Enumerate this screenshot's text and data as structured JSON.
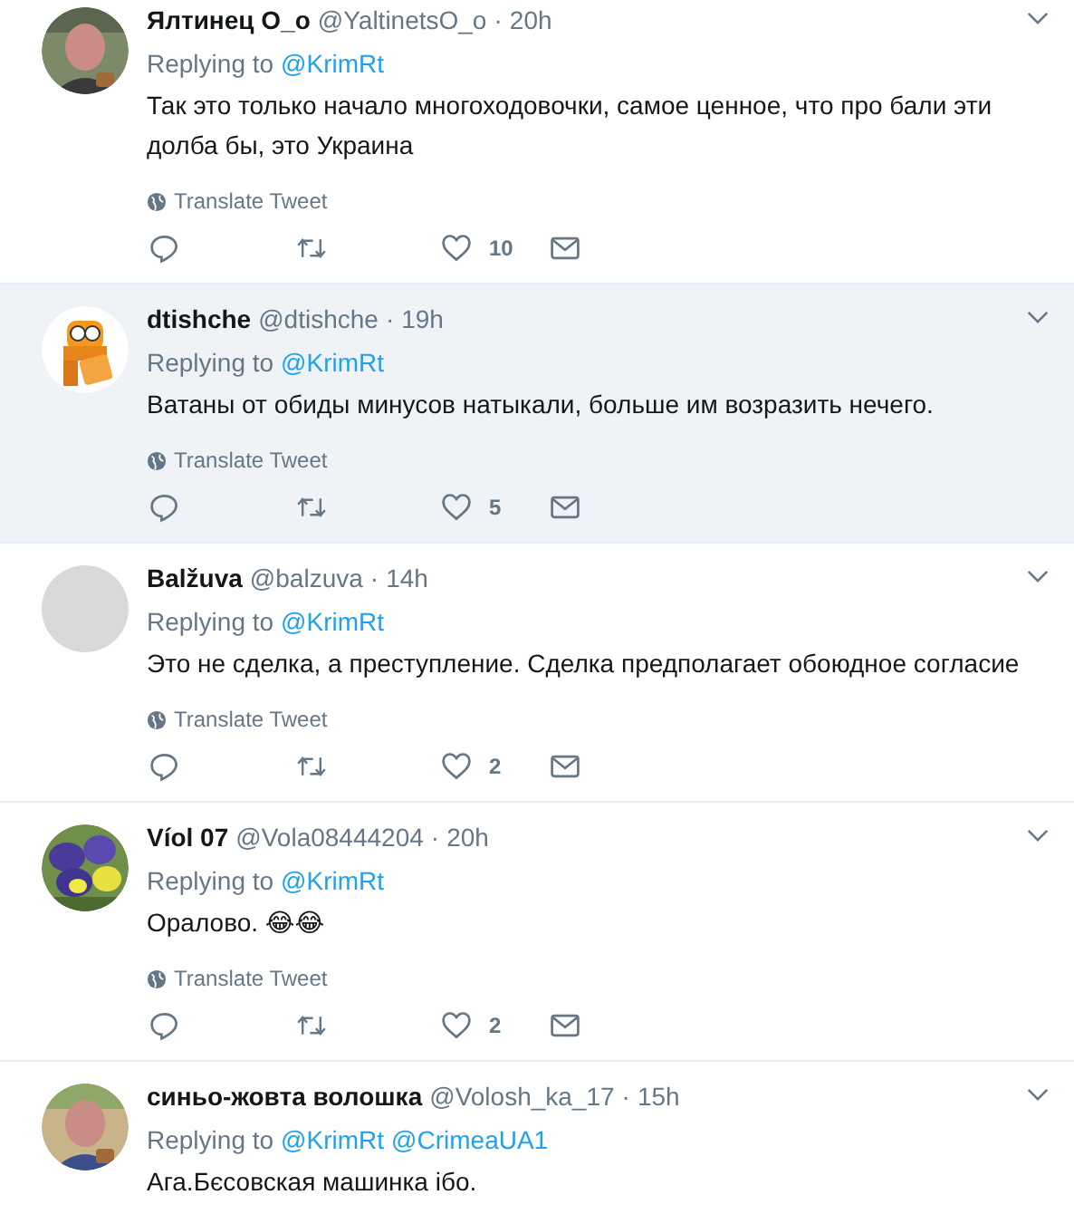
{
  "tweets": [
    {
      "name": "Ялтинец О_о",
      "handle": "@YaltinetsO_o",
      "separator": "·",
      "time": "20h",
      "highlighted": false,
      "replying_label": "Replying to",
      "replying_to": [
        "@KrimRt"
      ],
      "text": "Так это только начало многоходовочки, самое ценное, что про бали эти долба бы, это Украина",
      "translate": "Translate Tweet",
      "likes": "10"
    },
    {
      "name": "dtishche",
      "handle": "@dtishche",
      "separator": "·",
      "time": "19h",
      "highlighted": true,
      "replying_label": "Replying to",
      "replying_to": [
        "@KrimRt"
      ],
      "text": "Ватаны от обиды минусов натыкали, больше им возразить нечего.",
      "translate": "Translate Tweet",
      "likes": "5"
    },
    {
      "name": "Balžuva",
      "handle": "@balzuva",
      "separator": "·",
      "time": "14h",
      "highlighted": false,
      "replying_label": "Replying to",
      "replying_to": [
        "@KrimRt"
      ],
      "text": "Это не сделка, а преступление. Сделка предполагает обоюдное согласие",
      "translate": "Translate Tweet",
      "likes": "2"
    },
    {
      "name": "Víol 07",
      "handle": "@Vola08444204",
      "separator": "·",
      "time": "20h",
      "highlighted": false,
      "replying_label": "Replying to",
      "replying_to": [
        "@KrimRt"
      ],
      "text": "Оралово. 😂😂",
      "translate": "Translate Tweet",
      "likes": "2"
    },
    {
      "name": "синьо-жовта волошка",
      "handle": "@Volosh_ka_17",
      "separator": "·",
      "time": "15h",
      "highlighted": false,
      "replying_label": "Replying to",
      "replying_to": [
        "@KrimRt",
        "@CrimeaUA1"
      ],
      "text": "Ага.Бєсовская машинка ібо."
    }
  ]
}
